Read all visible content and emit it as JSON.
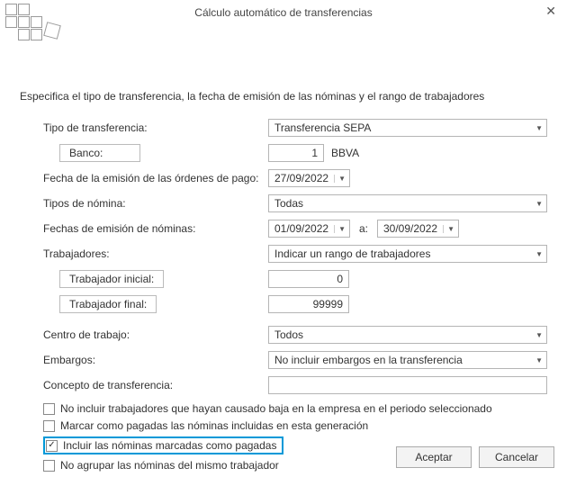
{
  "window": {
    "title": "Cálculo automático de transferencias"
  },
  "instruction": "Especifica el tipo de transferencia, la fecha de emisión de las nóminas y el rango de trabajadores",
  "form": {
    "tipo_transferencia_label": "Tipo de transferencia:",
    "tipo_transferencia_value": "Transferencia SEPA",
    "banco_label": "Banco:",
    "banco_num": "1",
    "banco_name": "BBVA",
    "fecha_ordenes_label": "Fecha de la emisión de las órdenes de pago:",
    "fecha_ordenes_value": "27/09/2022",
    "tipos_nomina_label": "Tipos de nómina:",
    "tipos_nomina_value": "Todas",
    "fechas_emision_label": "Fechas de emisión de nóminas:",
    "fecha_desde": "01/09/2022",
    "a_label": "a:",
    "fecha_hasta": "30/09/2022",
    "trabajadores_label": "Trabajadores:",
    "trabajadores_value": "Indicar un rango de trabajadores",
    "trabajador_inicial_label": "Trabajador inicial:",
    "trabajador_inicial_value": "0",
    "trabajador_final_label": "Trabajador final:",
    "trabajador_final_value": "99999",
    "centro_label": "Centro de trabajo:",
    "centro_value": "Todos",
    "embargos_label": "Embargos:",
    "embargos_value": "No incluir embargos en la transferencia",
    "concepto_label": "Concepto de transferencia:",
    "concepto_value": ""
  },
  "checks": {
    "c1": "No incluir trabajadores que hayan causado baja en la empresa en el periodo seleccionado",
    "c2": "Marcar como pagadas las nóminas incluidas en esta generación",
    "c3": "Incluir las nóminas marcadas como pagadas",
    "c4": "No agrupar las nóminas del mismo trabajador"
  },
  "buttons": {
    "accept": "Aceptar",
    "cancel": "Cancelar"
  }
}
